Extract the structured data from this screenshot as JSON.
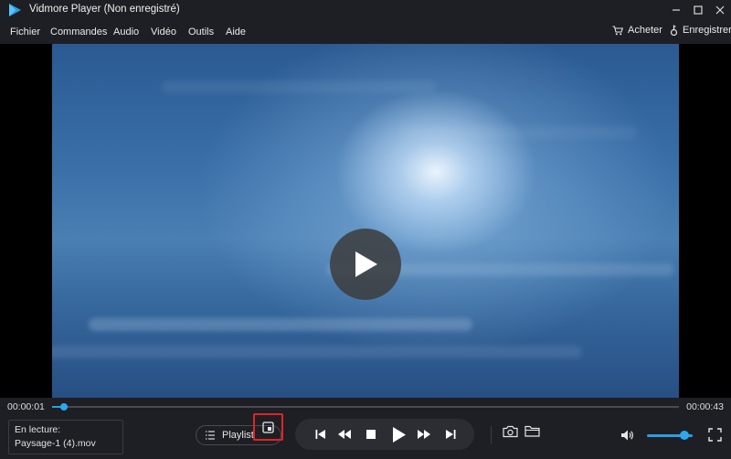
{
  "window": {
    "title": "Vidmore Player (Non enregistré)"
  },
  "menu": {
    "items": [
      "Fichier",
      "Commandes",
      "Audio",
      "Vidéo",
      "Outils",
      "Aide"
    ],
    "buy_label": "Acheter",
    "register_label": "Enregistrer"
  },
  "playback": {
    "current_time": "00:00:01",
    "total_time": "00:00:43",
    "progress": 0.019,
    "volume": 0.75
  },
  "now_playing": {
    "label": "En lecture:",
    "filename": "Paysage-1 (4).mov"
  },
  "playlist": {
    "label": "Playlist"
  },
  "colors": {
    "accent": "#2aa8f0",
    "highlight_box": "#e02424",
    "background": "#1e1f24"
  }
}
